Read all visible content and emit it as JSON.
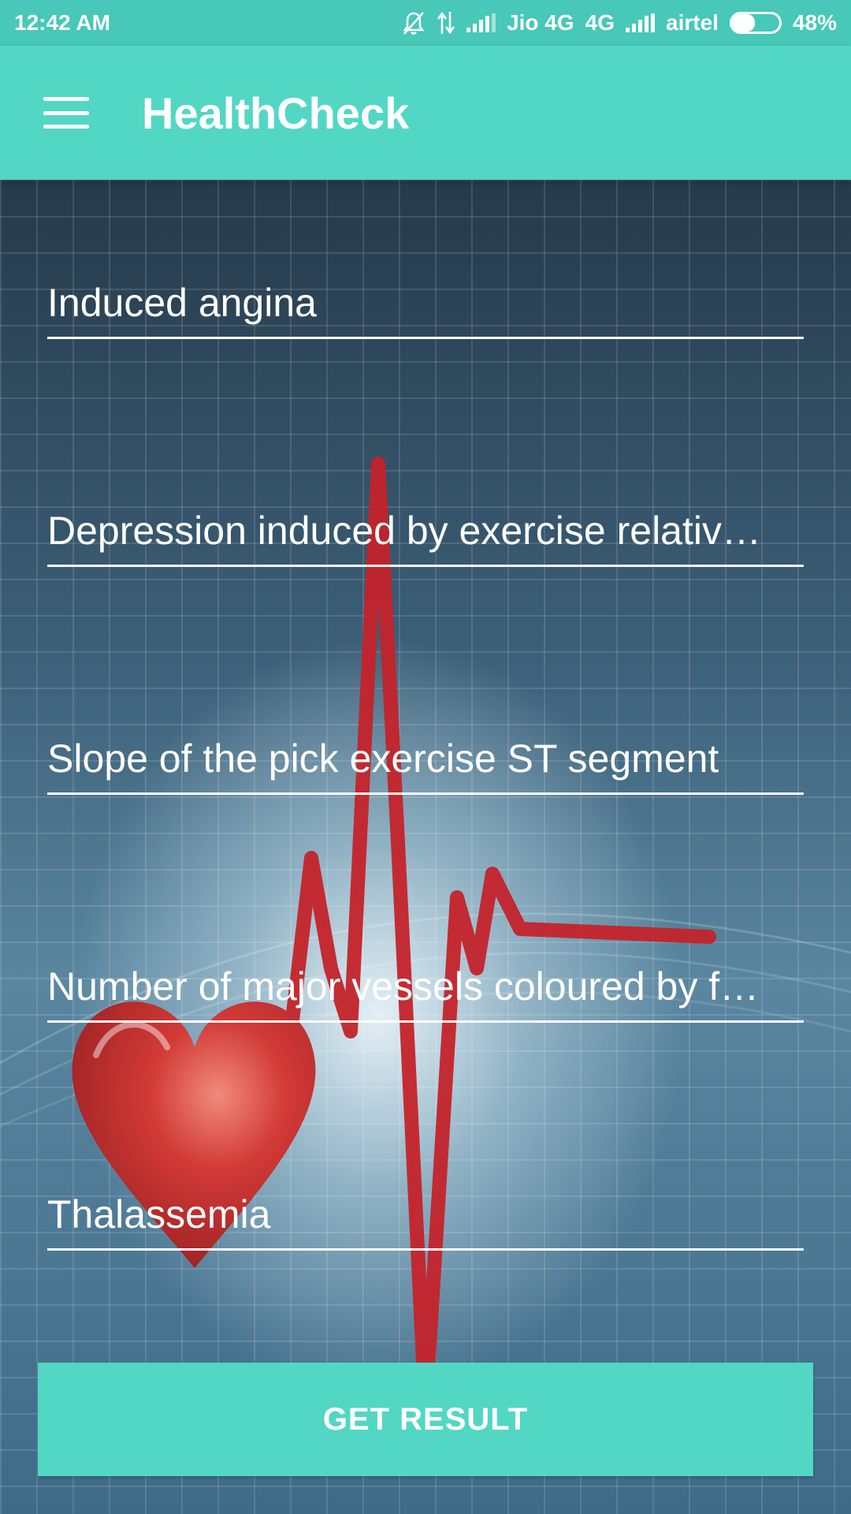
{
  "status_bar": {
    "time": "12:42 AM",
    "carrier1": "Jio 4G",
    "network1": "4G",
    "carrier2": "airtel",
    "battery_percent": "48%",
    "battery_level": 0.48,
    "icons": [
      "bell-off-icon",
      "data-transfer-icon",
      "signal-icon",
      "signal-icon",
      "battery-icon"
    ]
  },
  "app_bar": {
    "title": "HealthCheck",
    "menu_icon": "hamburger-menu-icon"
  },
  "form": {
    "fields": [
      {
        "placeholder": "Induced angina"
      },
      {
        "placeholder": "Depression induced by exercise relativ…"
      },
      {
        "placeholder": "Slope of the pick exercise ST segment"
      },
      {
        "placeholder": "Number of major vessels coloured by f…"
      },
      {
        "placeholder": "Thalassemia"
      }
    ]
  },
  "button": {
    "label": "GET RESULT"
  },
  "colors": {
    "accent": "#52d7c4",
    "status_bar": "#47c8b8",
    "text": "#ffffff",
    "heart": "#c0282d",
    "ecg_line": "#c4232a"
  },
  "background_image": "heart-ecg-illustration"
}
